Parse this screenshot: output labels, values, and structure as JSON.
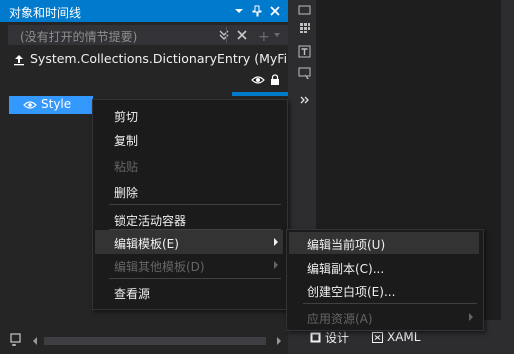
{
  "panel": {
    "title": "对象和时间线",
    "story_placeholder": "(没有打开的情节提要)",
    "object_path": "System.Collections.DictionaryEntry (MyFirs...",
    "style_label": "Style"
  },
  "context_menu": {
    "items": [
      {
        "label": "剪切",
        "enabled": true
      },
      {
        "label": "复制",
        "enabled": true
      },
      {
        "label": "粘贴",
        "enabled": false
      },
      {
        "label": "删除",
        "enabled": true
      },
      {
        "label": "锁定活动容器",
        "enabled": true
      },
      {
        "label": "编辑模板(E)",
        "enabled": true,
        "highlighted": true
      },
      {
        "label": "编辑其他模板(D)",
        "enabled": false
      },
      {
        "label": "查看源",
        "enabled": true
      }
    ]
  },
  "submenu": {
    "items": [
      {
        "label": "编辑当前项(U)",
        "enabled": true,
        "highlighted": true
      },
      {
        "label": "编辑副本(C)...",
        "enabled": true
      },
      {
        "label": "创建空白项(E)...",
        "enabled": true
      },
      {
        "label": "应用资源(A)",
        "enabled": false
      }
    ]
  },
  "tabs": {
    "design_label": "设计",
    "xaml_label": "XAML"
  },
  "colors": {
    "accent": "#007acc",
    "selection": "#3399ff",
    "menu_bg": "#1b1b1c",
    "menu_highlight": "#333334",
    "disabled_text": "#656565"
  },
  "icons": [
    "pin-icon",
    "close-icon",
    "collapse-icon",
    "add-icon",
    "up-arrow-icon",
    "eye-icon",
    "lock-icon",
    "style-icon",
    "more-icon",
    "text-tool-icon",
    "design-icon",
    "xaml-icon"
  ]
}
